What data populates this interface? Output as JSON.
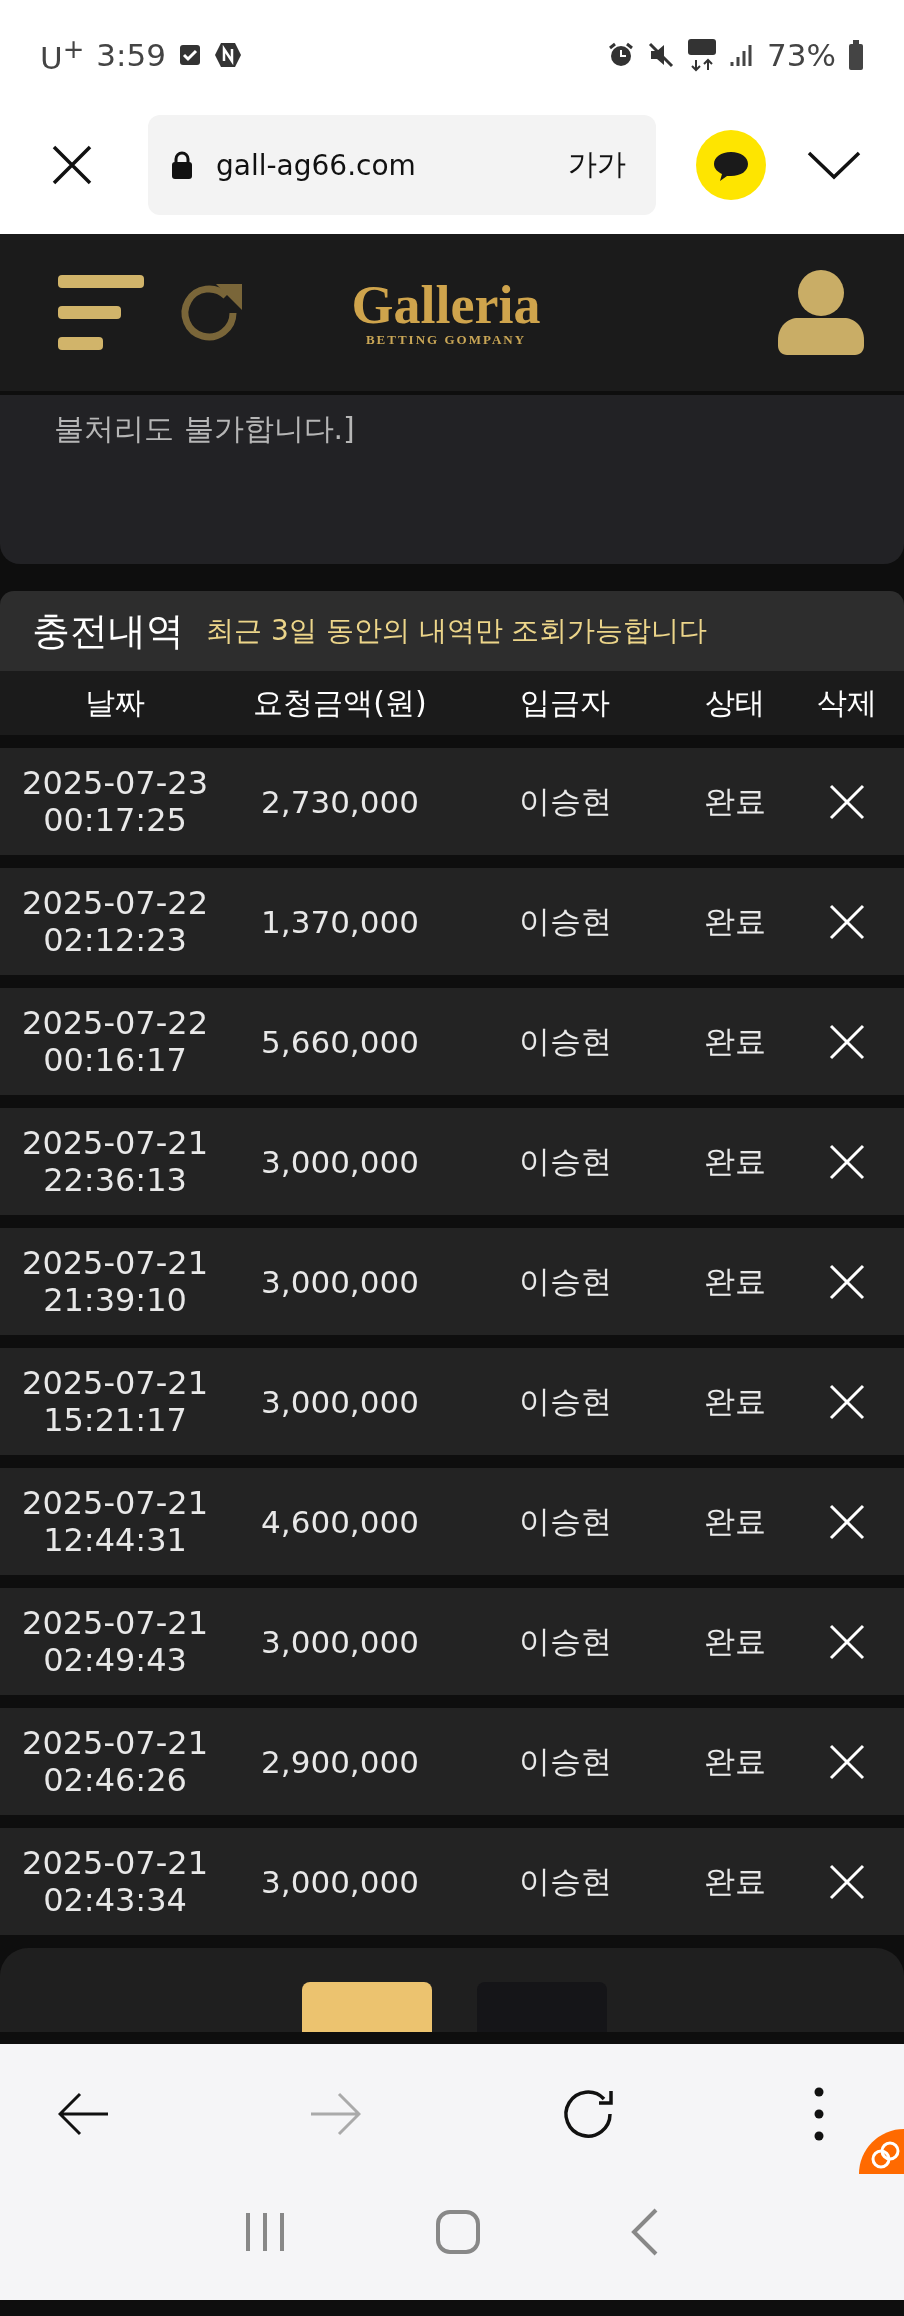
{
  "status_bar": {
    "carrier": "U$^{+}$",
    "time": "3:59",
    "battery": "73%"
  },
  "browser": {
    "url": "gall-ag66.com",
    "text_size": "가가"
  },
  "site": {
    "logo": "Galleria",
    "tagline": "BETTING GOMPANY"
  },
  "notice": {
    "text": "불처리도 불가합니다.]"
  },
  "history": {
    "title": "충전내역",
    "note": "최근 3일 동안의 내역만 조회가능합니다",
    "columns": [
      "날짜",
      "요청금액(원)",
      "입금자",
      "상태",
      "삭제"
    ],
    "rows": [
      {
        "date": "2025-07-23",
        "time": "00:17:25",
        "amount": "2,730,000",
        "depositor": "이승현",
        "status": "완료"
      },
      {
        "date": "2025-07-22",
        "time": "02:12:23",
        "amount": "1,370,000",
        "depositor": "이승현",
        "status": "완료"
      },
      {
        "date": "2025-07-22",
        "time": "00:16:17",
        "amount": "5,660,000",
        "depositor": "이승현",
        "status": "완료"
      },
      {
        "date": "2025-07-21",
        "time": "22:36:13",
        "amount": "3,000,000",
        "depositor": "이승현",
        "status": "완료"
      },
      {
        "date": "2025-07-21",
        "time": "21:39:10",
        "amount": "3,000,000",
        "depositor": "이승현",
        "status": "완료"
      },
      {
        "date": "2025-07-21",
        "time": "15:21:17",
        "amount": "3,000,000",
        "depositor": "이승현",
        "status": "완료"
      },
      {
        "date": "2025-07-21",
        "time": "12:44:31",
        "amount": "4,600,000",
        "depositor": "이승현",
        "status": "완료"
      },
      {
        "date": "2025-07-21",
        "time": "02:49:43",
        "amount": "3,000,000",
        "depositor": "이승현",
        "status": "완료"
      },
      {
        "date": "2025-07-21",
        "time": "02:46:26",
        "amount": "2,900,000",
        "depositor": "이승현",
        "status": "완료"
      },
      {
        "date": "2025-07-21",
        "time": "02:43:34",
        "amount": "3,000,000",
        "depositor": "이승현",
        "status": "완료"
      }
    ]
  },
  "pagination": [
    {
      "selected": true
    },
    {
      "selected": false
    }
  ]
}
